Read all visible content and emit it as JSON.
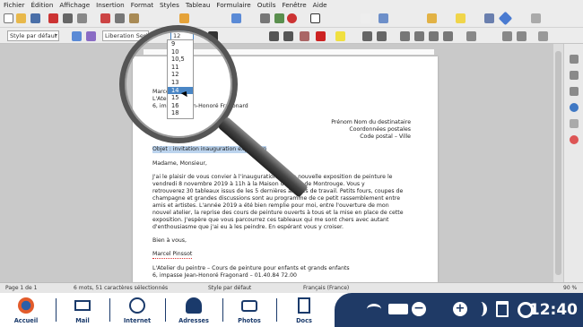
{
  "menu": [
    "Fichier",
    "Édition",
    "Affichage",
    "Insertion",
    "Format",
    "Styles",
    "Tableau",
    "Formulaire",
    "Outils",
    "Fenêtre",
    "Aide"
  ],
  "toolbar": {
    "paragraph_style": "Style par défaut",
    "font_name": "Liberation Serif",
    "font_size": "12"
  },
  "font_size_options": [
    "9",
    "10",
    "10,5",
    "11",
    "12",
    "13",
    "14",
    "15",
    "16",
    "18"
  ],
  "font_size_highlight": "14",
  "document": {
    "sender": [
      "Marcel",
      "L'Atelier",
      "6, impasse Jean-Honoré Fragonard"
    ],
    "recipient": [
      "Prénom Nom du destinataire",
      "Coordonnées postales",
      "Code postal – Ville"
    ],
    "subject": "Objet : invitation inauguration exposition",
    "salutation": "Madame, Monsieur,",
    "body": [
      "J'ai le plaisir de vous convier à l'inauguration de ma nouvelle exposition de peinture le",
      "vendredi 8 novembre 2019 à 11h à la Maison des arts de Montrouge. Vous y",
      "retrouverez 30 tableaux issus de les 5 dernières années de travail. Petits fours, coupes de",
      "champagne et grandes discussions sont au programme de ce petit rassemblement entre",
      "amis et artistes. L'année 2019 a été bien remplie pour moi, entre l'ouverture de mon",
      "nouvel atelier, la reprise des cours de peinture ouverts à tous et la mise en place de cette",
      "exposition. J'espère que vous parcourrez ces tableaux qui me sont chers avec autant",
      "d'enthousiasme que j'ai eu à les peindre. En espérant vous y croiser."
    ],
    "closing": "Bien à vous,",
    "signature": "Marcel Pinssot",
    "footer": [
      "L'Atelier du peintre – Cours de peinture pour enfants et grands enfants",
      "6, impasse Jean-Honoré Fragonard – 01.40.84 72.00"
    ]
  },
  "statusbar": {
    "page": "Page 1 de 1",
    "words": "6 mots, 51 caractères sélectionnés",
    "style": "Style par défaut",
    "language": "Français (France)",
    "zoom": "90 %"
  },
  "taskbar": {
    "apps": [
      "Accueil",
      "Mail",
      "Internet",
      "Adresses",
      "Photos",
      "Docs"
    ],
    "clock": "12:40"
  },
  "colors": {
    "tray_bg": "#1f3a66",
    "accent": "#4a86c5",
    "taskbar_label": "#1a3a6b"
  }
}
